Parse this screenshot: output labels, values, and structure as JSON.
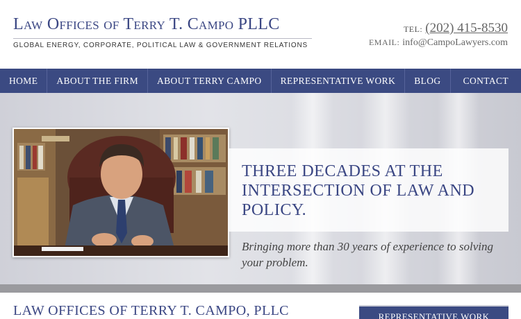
{
  "header": {
    "firm_name": "Law Offices of Terry T. Campo PLLC",
    "tagline": "GLOBAL ENERGY, CORPORATE, POLITICAL LAW & GOVERNMENT RELATIONS",
    "tel_label": "TEL:",
    "tel_number": "(202) 415-8530",
    "email_label": "EMAIL:",
    "email": "info@CampoLawyers.com"
  },
  "nav": {
    "items": [
      {
        "label": "HOME"
      },
      {
        "label": "ABOUT THE FIRM"
      },
      {
        "label": "ABOUT TERRY CAMPO"
      },
      {
        "label": "REPRESENTATIVE WORK"
      },
      {
        "label": "BLOG"
      },
      {
        "label": "CONTACT"
      }
    ]
  },
  "hero": {
    "heading": "THREE DECADES AT THE INTERSECTION OF LAW AND POLICY.",
    "subheading": "Bringing more than 30 years of experience to solving your problem."
  },
  "main": {
    "heading": "LAW OFFICES OF TERRY T. CAMPO, PLLC",
    "sidebar_button": "REPRESENTATIVE WORK"
  },
  "colors": {
    "brand_blue": "#3b4a82",
    "heading_blue": "#3a4683"
  }
}
